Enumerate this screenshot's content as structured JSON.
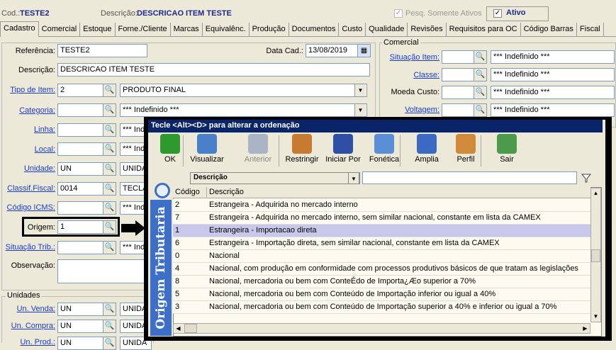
{
  "header": {
    "cod_label": "Cod.:",
    "cod_value": "TESTE2",
    "desc_label": "Descrição:",
    "desc_value": "DESCRICAO ITEM TESTE",
    "pesq_label": "Pesq. Somente Ativos",
    "pesq_checked": "✓",
    "ativo_label": "Ativo",
    "ativo_checked": "✓"
  },
  "tabs": [
    "Cadastro",
    "Comercial",
    "Estoque",
    "Forne./Cliente",
    "Marcas",
    "Equivalênc.",
    "Produção",
    "Documentos",
    "Custo",
    "Qualidade",
    "Revisões",
    "Requisitos para OC",
    "Código Barras",
    "Fiscal"
  ],
  "form": {
    "referencia_label": "Referência:",
    "referencia_value": "TESTE2",
    "datacad_label": "Data Cad.:",
    "datacad_value": "13/08/2019",
    "descricao_label": "Descrição:",
    "descricao_value": "DESCRICAO ITEM TESTE",
    "tipo_label": "Tipo de Item:",
    "tipo_code": "2",
    "tipo_desc": "PRODUTO FINAL",
    "categoria_label": "Categoria:",
    "categoria_desc": "*** Indefinido ***",
    "linha_label": "Linha:",
    "linha_desc": "*** Ind",
    "local_label": "Local:",
    "local_desc": "*** Ind",
    "unidade_label": "Unidade:",
    "unidade_code": "UN",
    "unidade_desc": "UNIDA",
    "classif_label": "Classif.Fiscal:",
    "classif_code": "0014",
    "classif_desc": "TECLA",
    "icms_label": "Código ICMS:",
    "icms_desc": "*** Ind",
    "origem_label": "Origem:",
    "origem_code": "1",
    "sittrib_label": "Situação Trib.:",
    "sittrib_desc": "*** Ind",
    "obs_label": "Observação:",
    "unidades_title": "Unidades",
    "unvenda_label": "Un. Venda:",
    "unvenda_code": "UN",
    "unvenda_desc": "UNIDA",
    "uncompra_label": "Un. Compra:",
    "uncompra_code": "UN",
    "uncompra_desc": "UNIDA",
    "unprod_label": "Un. Prod.:",
    "unprod_code": "UN",
    "unprod_desc": "UNIDA"
  },
  "comercial": {
    "title": "Comercial",
    "situacao_label": "Situação Item:",
    "situacao_desc": "*** Indefinido ***",
    "classe_label": "Classe:",
    "classe_desc": "*** Indefinido ***",
    "moeda_label": "Moeda Custo:",
    "moeda_desc": "*** Indefinido ***",
    "voltagem_label": "Voltagem:",
    "voltagem_desc": "*** Indefinido ***"
  },
  "popup": {
    "title": "Tecle <Alt><D> para alterar a ordenação",
    "toolbar": [
      {
        "label": "OK",
        "icon": "check-icon",
        "color": "#2e9a2e",
        "enabled": true
      },
      {
        "label": "Visualizar",
        "icon": "magnifier-doc-icon",
        "color": "#4a7fc9",
        "enabled": true
      },
      {
        "label": "Anterior",
        "icon": "back-icon",
        "color": "#aab4c4",
        "enabled": false
      },
      {
        "label": "Restringir",
        "icon": "filter-people-icon",
        "color": "#c77b30",
        "enabled": true
      },
      {
        "label": "Iniciar Por",
        "icon": "abc-index-icon",
        "color": "#2f4fa6",
        "enabled": true
      },
      {
        "label": "Fonética",
        "icon": "phonetic-search-icon",
        "color": "#5a8fd6",
        "enabled": true
      },
      {
        "label": "Amplia",
        "icon": "window-maximize-icon",
        "color": "#3c6ac2",
        "enabled": true
      },
      {
        "label": "Perfil",
        "icon": "users-profile-icon",
        "color": "#d08a3a",
        "enabled": true
      },
      {
        "label": "Sair",
        "icon": "exit-door-icon",
        "color": "#4c9a4c",
        "enabled": true
      }
    ],
    "search_field_label": "Descrição",
    "search_value": "",
    "banner_text": "Origem Tributaria",
    "columns": [
      "Código",
      "Descrição"
    ],
    "rows": [
      {
        "code": "2",
        "desc": "Estrangeira - Adquirida no mercado interno"
      },
      {
        "code": "7",
        "desc": "Estrangeira - Adquirida no mercado interno, sem similar nacional, constante em lista da CAMEX"
      },
      {
        "code": "1",
        "desc": "Estrangeira - Importacao direta"
      },
      {
        "code": "6",
        "desc": "Estrangeira - Importação direta, sem similar nacional, constante em lista da CAMEX"
      },
      {
        "code": "0",
        "desc": "Nacional"
      },
      {
        "code": "4",
        "desc": "Nacional, com produção em conformidade com processos produtivos básicos de que tratam as legislações"
      },
      {
        "code": "8",
        "desc": "Nacional, mercadoria ou bem com ConteÉdo de Importa¿Æo superior a 70%"
      },
      {
        "code": "5",
        "desc": "Nacional, mercadoria ou bem com Conteúdo de Importação inferior ou igual a 40%"
      },
      {
        "code": "3",
        "desc": "Nacional, mercadoria ou bem com Conteúdo de Importação superior a 40% e inferior ou igual a 70%"
      }
    ],
    "selected_row": 2
  }
}
